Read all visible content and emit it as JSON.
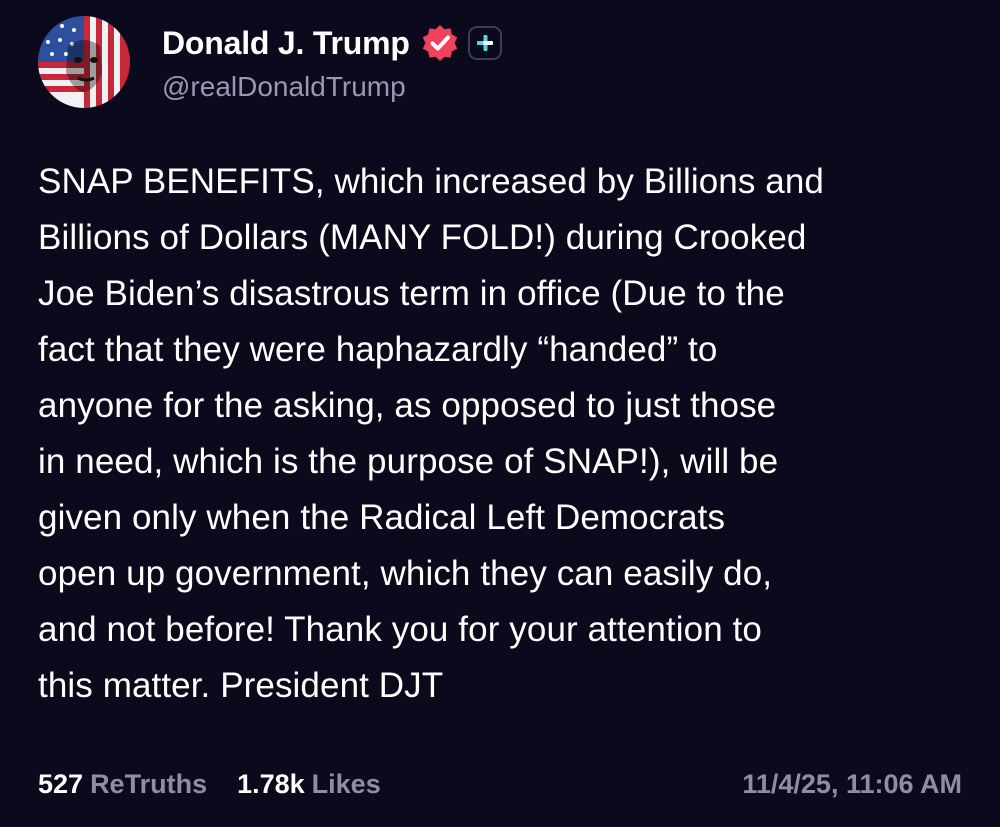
{
  "author": {
    "display_name": "Donald J. Trump",
    "handle": "@realDonaldTrump",
    "verified_icon": "verified-badge-icon",
    "plus_icon": "plus-icon",
    "verified_color": "#f0425d"
  },
  "post": {
    "text": "SNAP BENEFITS, which increased by Billions and\nBillions of Dollars (MANY FOLD!) during Crooked\nJoe Biden’s disastrous term in office (Due to the\nfact that they were haphazardly “handed” to\nanyone for the asking, as opposed to just those\nin need, which is the purpose of SNAP!), will be\ngiven only when the Radical Left Democrats\nopen up government, which they can easily do,\nand not before! Thank you for your attention to\nthis matter. President DJT"
  },
  "stats": {
    "retruths_count": "527",
    "retruths_label": "ReTruths",
    "likes_count": "1.78k",
    "likes_label": "Likes",
    "timestamp": "11/4/25, 11:06 AM"
  },
  "colors": {
    "background": "#0b0a1c",
    "text": "#ffffff",
    "muted": "#8f8da6",
    "accent": "#f0425d"
  }
}
